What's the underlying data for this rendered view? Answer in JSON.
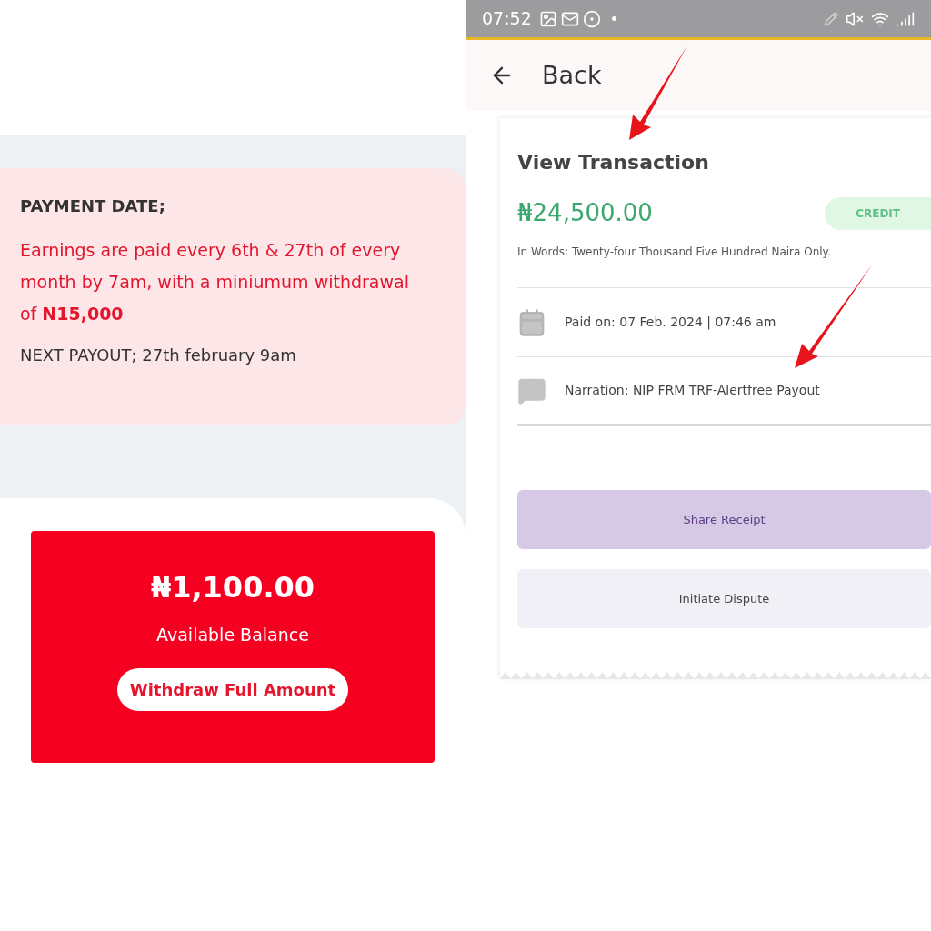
{
  "left_screen": {
    "payment_card": {
      "heading": "PAYMENT DATE;",
      "notice": "Earnings are paid every 6th & 27th of every month by 7am, with a miniumum withdrawal of **N15,000**",
      "next_payout": "NEXT PAYOUT; 27th february 9am"
    },
    "balance_card": {
      "amount": "₦1,100.00",
      "label": "Available Balance",
      "button": "Withdraw Full Amount"
    }
  },
  "right_screen": {
    "status_bar": {
      "time": "07:52"
    },
    "header": {
      "back": "Back"
    },
    "receipt": {
      "title": "View Transaction",
      "amount": "₦24,500.00",
      "badge": "CREDIT",
      "in_words": "In Words: Twenty-four Thousand Five Hundred Naira  Only.",
      "details": [
        {
          "kind": "date",
          "text": "Paid on: 07 Feb. 2024 | 07:46 am"
        },
        {
          "kind": "narration",
          "text": "Narration: NIP FRM TRF-Alertfree Payout"
        }
      ],
      "buttons": [
        {
          "kind": "primary",
          "label": "Share Receipt"
        },
        {
          "kind": "secondary",
          "label": "Initiate Dispute"
        }
      ]
    }
  }
}
